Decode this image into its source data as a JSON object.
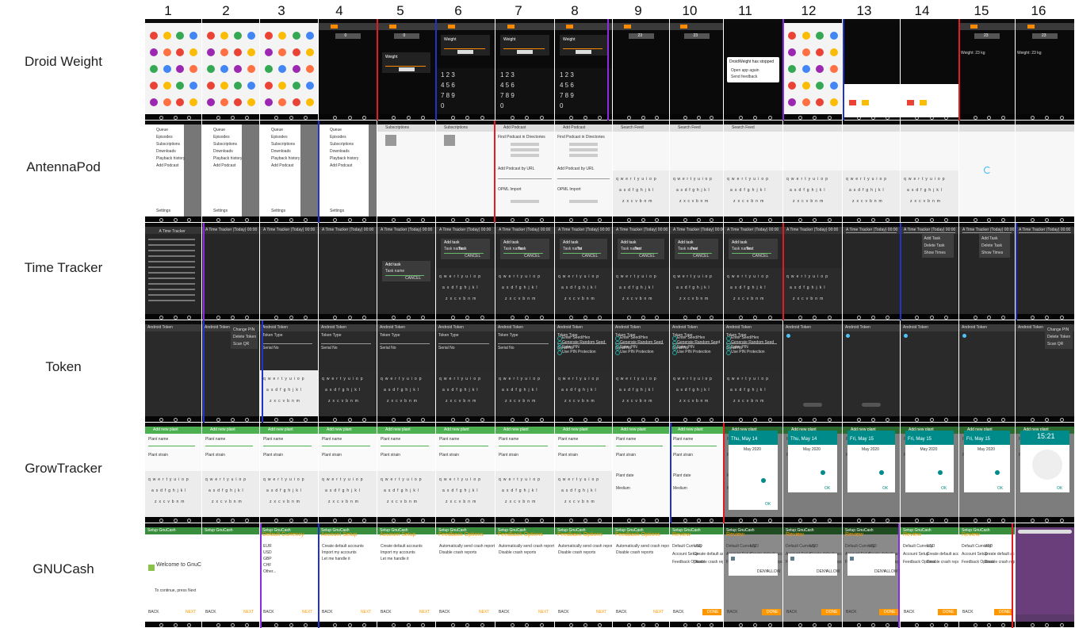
{
  "column_headers": [
    "1",
    "2",
    "3",
    "4",
    "5",
    "6",
    "7",
    "8",
    "9",
    "10",
    "11",
    "12",
    "13",
    "14",
    "15",
    "16"
  ],
  "row_labels": [
    "Droid Weight",
    "AntennaPod",
    "Time Tracker",
    "Token",
    "GrowTracker",
    "GNUCash"
  ],
  "colors": {
    "red_divider": "#e31b23",
    "blue_divider": "#2233cc",
    "purple_divider": "#8a2be2",
    "droid_accent": "#ff8a00",
    "growtracker_green": "#4caf50",
    "growtracker_teal": "#008b8b",
    "gnucash_green": "#388e3c",
    "gnucash_orange": "#ff9800",
    "time_tracker_green": "#66bb6a",
    "token_teal": "#26a69a"
  },
  "droid_weight": {
    "stepper_values": [
      "0",
      "0",
      "23",
      "23",
      "23",
      "23"
    ],
    "weight_label": "Weight",
    "stopped_dialog": "DroidWeight has stopped",
    "stopped_options": [
      "Open app again",
      "Send feedback"
    ],
    "weight_readout": "Weight: 23 kg"
  },
  "antennapod": {
    "nav_items": [
      "Queue",
      "Episodes",
      "Subscriptions",
      "Downloads",
      "Playback history",
      "Add Podcast"
    ],
    "settings_label": "Settings",
    "subscriptions_title": "Subscriptions",
    "add_podcast_title": "Add Podcast",
    "find_in_directories": "Find Podcast in Directories",
    "add_by_url": "Add Podcast by URL",
    "opml_import": "OPML Import",
    "search_placeholder": "Search Feed"
  },
  "time_tracker": {
    "title": "A Time Tracker (Today) 00:00",
    "welcome": "A Time Tracker",
    "add_task": "Add task",
    "task_name_label": "Task name",
    "cancel": "CANCEL",
    "add": "ADD TASK",
    "task_names": [
      "Task",
      "Task",
      "Tst",
      "Test",
      "Test",
      "Test"
    ],
    "menu_items": [
      "Add Task",
      "Delete Task",
      "Show Times"
    ]
  },
  "token": {
    "title": "Android Token",
    "token_type": "Token Type",
    "token_types": [
      "Event Token",
      "Time Token"
    ],
    "serial_label": "Serial No",
    "otp_length": "OTP Length",
    "next": "NEXT",
    "radio_options": [
      "Enter Seed/Hex",
      "Generate Random Seed",
      "Enter PIN",
      "Use PIN Protection"
    ],
    "complete": "COMPLETE",
    "menu_items": [
      "Change PIN",
      "Delete Token",
      "Scan QR"
    ]
  },
  "growtracker": {
    "title": "Add new plant",
    "plant_name_label": "Plant name",
    "plant_name_values": [
      "Plant name",
      "Plant name",
      "Plant name",
      "Plant name",
      "Plant name",
      "Plant name",
      "Plant name",
      "Plant name",
      "Plant name",
      "Plant name"
    ],
    "plant_strain_label": "Plant strain",
    "suggestions": [
      "Flowed",
      "Flower",
      "Flowering"
    ],
    "plant_date_label": "Plant date",
    "medium_label": "Medium",
    "dates": [
      "Thu, May 14",
      "Thu, May 14",
      "Fri, May 15",
      "Fri, May 15",
      "Fri, May 15"
    ],
    "month": "May 2020",
    "clock_time": "15:21",
    "cancel": "CANCEL",
    "ok": "OK"
  },
  "gnucash": {
    "header": "Setup GnuCash",
    "welcome": "Welcome to GnuCash",
    "welcome_body": "Before you dive in, let's setup a few things first",
    "continue_hint": "To continue, press Next",
    "default_currency": "Default Currency",
    "currencies": [
      "EUR",
      "USD",
      "GBP",
      "CHF",
      "Other..."
    ],
    "account_setup": "Account Setup",
    "account_options": [
      "Create default accounts",
      "Import my accounts",
      "Let me handle it"
    ],
    "feedback_options": "Feedback Options",
    "feedback_items": [
      "Automatically send crash reports",
      "Disable crash reports"
    ],
    "review": "Review",
    "review_rows": [
      "Default Currency",
      "Account Setup",
      "Feedback Options"
    ],
    "review_values": [
      "USD",
      "Create default accounts",
      "Disable crash reports"
    ],
    "permission_dialog": "Allow GnuCash to access photos, media, and files on your device?",
    "deny": "DENY",
    "allow": "ALLOW",
    "back": "BACK",
    "next": "NEXT",
    "done": "DONE"
  }
}
